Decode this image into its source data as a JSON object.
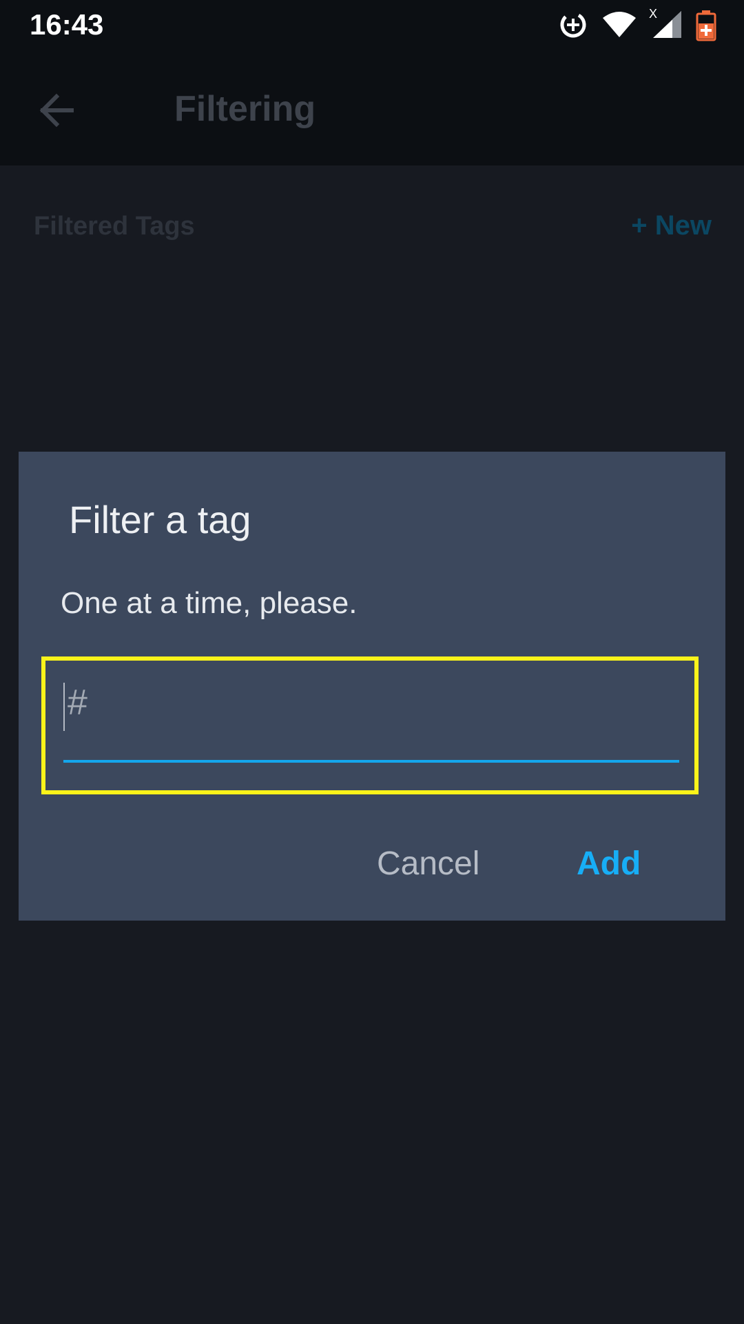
{
  "status_bar": {
    "time": "16:43",
    "icons": [
      "data-saver-icon",
      "wifi-icon",
      "cell-signal-no-data-icon",
      "battery-charging-icon"
    ]
  },
  "app_bar": {
    "back_icon": "arrow-left-icon",
    "title": "Filtering"
  },
  "section": {
    "title": "Filtered Tags",
    "new_label": "+ New"
  },
  "dialog": {
    "title": "Filter a tag",
    "message": "One at a time, please.",
    "input": {
      "value": "",
      "placeholder": "#"
    },
    "cancel_label": "Cancel",
    "add_label": "Add"
  },
  "colors": {
    "background": "#171a21",
    "bar_background": "#0c0f13",
    "dialog_background": "#3c485d",
    "accent": "#17aef6",
    "highlight": "#fbf31a",
    "battery": "#f06a3a"
  }
}
